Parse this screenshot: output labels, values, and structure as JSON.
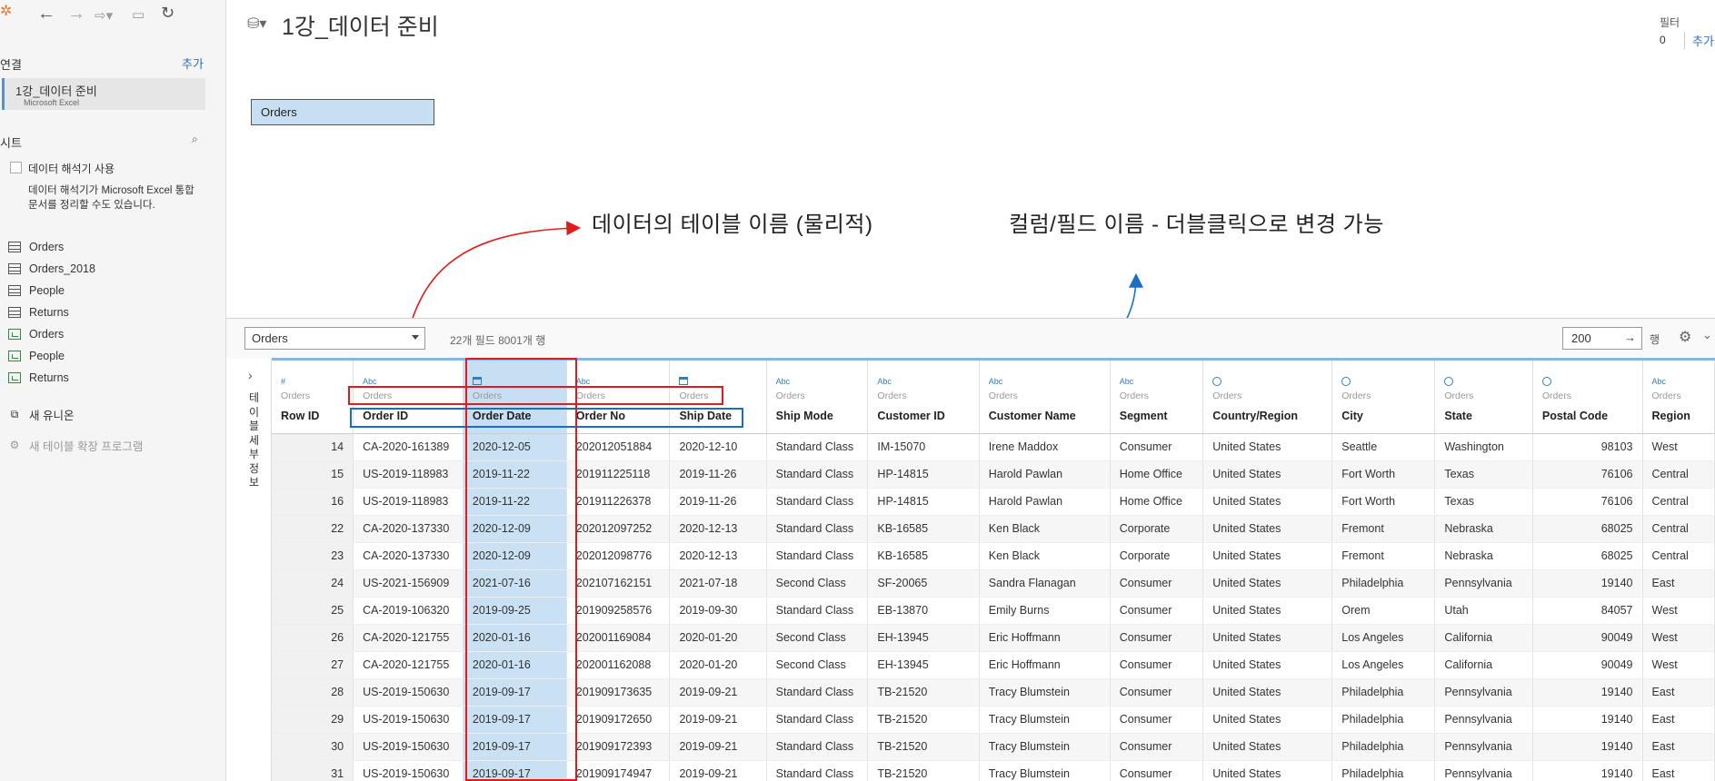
{
  "sidebar": {
    "connection_title": "연결",
    "add_label": "추가",
    "connection": {
      "name": "1강_데이터 준비",
      "type": "Microsoft Excel"
    },
    "sheets_title": "시트",
    "interpreter_label": "데이터 해석기 사용",
    "interpreter_hint": "데이터 해석기가 Microsoft Excel 통합 문서를 정리할 수도 있습니다.",
    "items": [
      {
        "label": "Orders",
        "icon": "table-icon"
      },
      {
        "label": "Orders_2018",
        "icon": "table-icon"
      },
      {
        "label": "People",
        "icon": "table-icon"
      },
      {
        "label": "Returns",
        "icon": "table-icon"
      },
      {
        "label": "Orders",
        "icon": "named-range-icon"
      },
      {
        "label": "People",
        "icon": "named-range-icon"
      },
      {
        "label": "Returns",
        "icon": "named-range-icon"
      }
    ],
    "new_union": "새 유니온",
    "new_extension": "새 테이블 확장 프로그램"
  },
  "canvas": {
    "title": "1강_데이터 준비",
    "filter_label": "필터",
    "filter_count": "0",
    "filter_add": "추가",
    "table_pill": "Orders"
  },
  "annotations": {
    "table_name": "데이터의 테이블 이름 (물리적)",
    "field_name": "컬럼/필드 이름 - 더블클릭으로 변경 가능",
    "red_color": "#e01b1b",
    "blue_color": "#1a6fc2"
  },
  "grid_toolbar": {
    "table_select": "Orders",
    "field_info": "22개 필드 8001개 행",
    "rows_value": "200",
    "rows_suffix": "행"
  },
  "details_label": "테이블세부정보",
  "table": {
    "columns": [
      {
        "type": "#",
        "source": "Orders",
        "name": "Row ID"
      },
      {
        "type": "Abc",
        "source": "Orders",
        "name": "Order ID"
      },
      {
        "type": "calendar-icon",
        "source": "Orders",
        "name": "Order Date"
      },
      {
        "type": "Abc",
        "source": "Orders",
        "name": "Order No"
      },
      {
        "type": "calendar-icon",
        "source": "Orders",
        "name": "Ship Date"
      },
      {
        "type": "Abc",
        "source": "Orders",
        "name": "Ship Mode"
      },
      {
        "type": "Abc",
        "source": "Orders",
        "name": "Customer ID"
      },
      {
        "type": "Abc",
        "source": "Orders",
        "name": "Customer Name"
      },
      {
        "type": "Abc",
        "source": "Orders",
        "name": "Segment"
      },
      {
        "type": "globe-icon",
        "source": "Orders",
        "name": "Country/Region"
      },
      {
        "type": "globe-icon",
        "source": "Orders",
        "name": "City"
      },
      {
        "type": "globe-icon",
        "source": "Orders",
        "name": "State"
      },
      {
        "type": "globe-icon",
        "source": "Orders",
        "name": "Postal Code"
      },
      {
        "type": "Abc",
        "source": "Orders",
        "name": "Region"
      }
    ],
    "rows": [
      [
        "14",
        "CA-2020-161389",
        "2020-12-05",
        "202012051884",
        "2020-12-10",
        "Standard Class",
        "IM-15070",
        "Irene Maddox",
        "Consumer",
        "United States",
        "Seattle",
        "Washington",
        "98103",
        "West"
      ],
      [
        "15",
        "US-2019-118983",
        "2019-11-22",
        "201911225118",
        "2019-11-26",
        "Standard Class",
        "HP-14815",
        "Harold Pawlan",
        "Home Office",
        "United States",
        "Fort Worth",
        "Texas",
        "76106",
        "Central"
      ],
      [
        "16",
        "US-2019-118983",
        "2019-11-22",
        "201911226378",
        "2019-11-26",
        "Standard Class",
        "HP-14815",
        "Harold Pawlan",
        "Home Office",
        "United States",
        "Fort Worth",
        "Texas",
        "76106",
        "Central"
      ],
      [
        "22",
        "CA-2020-137330",
        "2020-12-09",
        "202012097252",
        "2020-12-13",
        "Standard Class",
        "KB-16585",
        "Ken Black",
        "Corporate",
        "United States",
        "Fremont",
        "Nebraska",
        "68025",
        "Central"
      ],
      [
        "23",
        "CA-2020-137330",
        "2020-12-09",
        "202012098776",
        "2020-12-13",
        "Standard Class",
        "KB-16585",
        "Ken Black",
        "Corporate",
        "United States",
        "Fremont",
        "Nebraska",
        "68025",
        "Central"
      ],
      [
        "24",
        "US-2021-156909",
        "2021-07-16",
        "202107162151",
        "2021-07-18",
        "Second Class",
        "SF-20065",
        "Sandra Flanagan",
        "Consumer",
        "United States",
        "Philadelphia",
        "Pennsylvania",
        "19140",
        "East"
      ],
      [
        "25",
        "CA-2019-106320",
        "2019-09-25",
        "201909258576",
        "2019-09-30",
        "Standard Class",
        "EB-13870",
        "Emily Burns",
        "Consumer",
        "United States",
        "Orem",
        "Utah",
        "84057",
        "West"
      ],
      [
        "26",
        "CA-2020-121755",
        "2020-01-16",
        "202001169084",
        "2020-01-20",
        "Second Class",
        "EH-13945",
        "Eric Hoffmann",
        "Consumer",
        "United States",
        "Los Angeles",
        "California",
        "90049",
        "West"
      ],
      [
        "27",
        "CA-2020-121755",
        "2020-01-16",
        "202001162088",
        "2020-01-20",
        "Second Class",
        "EH-13945",
        "Eric Hoffmann",
        "Consumer",
        "United States",
        "Los Angeles",
        "California",
        "90049",
        "West"
      ],
      [
        "28",
        "US-2019-150630",
        "2019-09-17",
        "201909173635",
        "2019-09-21",
        "Standard Class",
        "TB-21520",
        "Tracy Blumstein",
        "Consumer",
        "United States",
        "Philadelphia",
        "Pennsylvania",
        "19140",
        "East"
      ],
      [
        "29",
        "US-2019-150630",
        "2019-09-17",
        "201909172650",
        "2019-09-21",
        "Standard Class",
        "TB-21520",
        "Tracy Blumstein",
        "Consumer",
        "United States",
        "Philadelphia",
        "Pennsylvania",
        "19140",
        "East"
      ],
      [
        "30",
        "US-2019-150630",
        "2019-09-17",
        "201909172393",
        "2019-09-21",
        "Standard Class",
        "TB-21520",
        "Tracy Blumstein",
        "Consumer",
        "United States",
        "Philadelphia",
        "Pennsylvania",
        "19140",
        "East"
      ],
      [
        "31",
        "US-2019-150630",
        "2019-09-17",
        "201909174947",
        "2019-09-21",
        "Standard Class",
        "TB-21520",
        "Tracy Blumstein",
        "Consumer",
        "United States",
        "Philadelphia",
        "Pennsylvania",
        "19140",
        "East"
      ]
    ]
  }
}
